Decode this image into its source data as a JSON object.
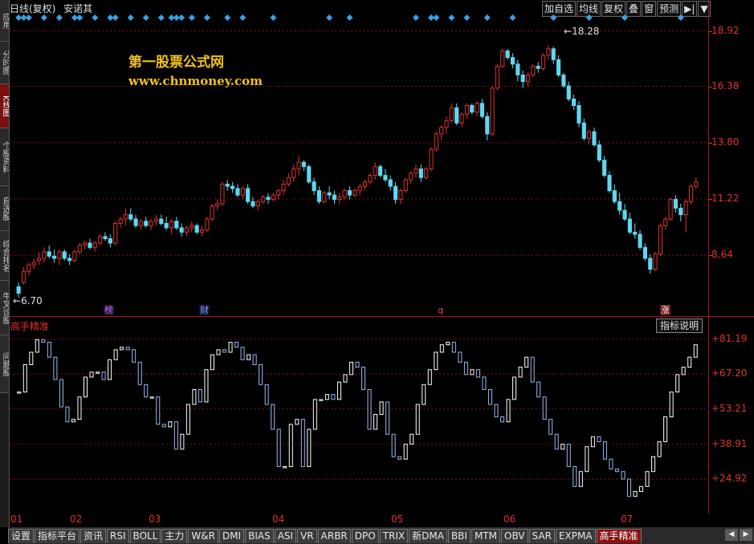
{
  "header": {
    "period": "日线(复权)",
    "stock_name": "安诺其",
    "buttons": [
      "加自选",
      "均线",
      "复权",
      "叠",
      "窗",
      "预测",
      "▶|",
      "▼"
    ]
  },
  "left_tabs": [
    {
      "label": "应用",
      "active": false
    },
    {
      "label": "分时图",
      "active": false
    },
    {
      "label": "K线图",
      "active": true
    },
    {
      "label": "个股资料",
      "active": false
    },
    {
      "label": "自选股",
      "active": false
    },
    {
      "label": "综合排名",
      "active": false
    },
    {
      "label": "牛叉诊股",
      "active": false
    },
    {
      "label": "问题股",
      "active": false
    }
  ],
  "watermark": {
    "line1": "第一股票公式网",
    "line2": "www.chnmoney.com"
  },
  "annotations": {
    "high": "18.28",
    "low": "6.70"
  },
  "events": [
    {
      "label": "榜",
      "color": "#c070ff",
      "bg": "#221122"
    },
    {
      "label": "财",
      "color": "#7aa8ff",
      "bg": "#111133"
    },
    {
      "label": "q",
      "color": "#ff4040",
      "bg": "transparent"
    },
    {
      "label": "涨",
      "color": "#ffffff",
      "bg": "#6a1111"
    }
  ],
  "price_axis": [
    "18.92",
    "16.38",
    "13.80",
    "11.22",
    "8.64"
  ],
  "indicator": {
    "name": "高手精准",
    "help_button": "指标说明",
    "axis": [
      "+81.19",
      "+67.20",
      "+53.21",
      "+38.91",
      "+24.92"
    ]
  },
  "months": [
    "01",
    "02",
    "03",
    "04",
    "05",
    "06",
    "07"
  ],
  "bottom_tabs": [
    "设置",
    "指标平台",
    "资讯",
    "RSI",
    "BOLL",
    "主力",
    "W&R",
    "DMI",
    "BIAS",
    "ASI",
    "VR",
    "ARBR",
    "DPO",
    "TRIX",
    "新DMA",
    "BBI",
    "MTM",
    "OBV",
    "SAR",
    "EXPMA",
    "高手精准"
  ],
  "active_bottom_tab": "高手精准",
  "colors": {
    "up": "#e03030",
    "down": "#5ed8f0",
    "grid": "#8a1010",
    "axis": "#e03030",
    "marker": "#3aa0e8",
    "ind_up": "#ffffff",
    "ind_down": "#9ab8f0"
  },
  "chart_data": {
    "type": "candlestick",
    "price_range": [
      6.0,
      19.6
    ],
    "ohlc": [
      [
        7.2,
        7.4,
        6.7,
        6.9
      ],
      [
        7.4,
        8.1,
        7.3,
        7.9
      ],
      [
        7.9,
        8.3,
        7.7,
        8.2
      ],
      [
        8.2,
        8.5,
        8.0,
        8.3
      ],
      [
        8.4,
        8.8,
        8.2,
        8.5
      ],
      [
        8.5,
        9.0,
        8.3,
        8.8
      ],
      [
        8.8,
        9.1,
        8.5,
        8.6
      ],
      [
        8.6,
        8.9,
        8.3,
        8.5
      ],
      [
        8.5,
        8.9,
        8.2,
        8.8
      ],
      [
        8.8,
        8.9,
        8.4,
        8.5
      ],
      [
        8.5,
        8.7,
        8.2,
        8.4
      ],
      [
        8.4,
        8.9,
        8.3,
        8.8
      ],
      [
        8.8,
        9.2,
        8.7,
        9.1
      ],
      [
        9.1,
        9.3,
        8.9,
        9.2
      ],
      [
        9.2,
        9.4,
        8.9,
        9.0
      ],
      [
        9.0,
        9.3,
        8.8,
        9.2
      ],
      [
        9.2,
        9.6,
        9.1,
        9.5
      ],
      [
        9.5,
        9.7,
        9.3,
        9.4
      ],
      [
        9.4,
        9.6,
        9.0,
        9.2
      ],
      [
        9.2,
        10.2,
        9.1,
        10.1
      ],
      [
        10.1,
        10.4,
        9.9,
        10.3
      ],
      [
        10.3,
        10.8,
        10.0,
        10.5
      ],
      [
        10.5,
        10.8,
        10.2,
        10.3
      ],
      [
        10.3,
        10.5,
        9.9,
        10.0
      ],
      [
        10.0,
        10.3,
        9.8,
        10.2
      ],
      [
        10.2,
        10.4,
        9.9,
        10.0
      ],
      [
        10.0,
        10.3,
        9.8,
        10.2
      ],
      [
        10.2,
        10.5,
        10.0,
        10.3
      ],
      [
        10.3,
        10.5,
        10.0,
        10.1
      ],
      [
        10.1,
        10.4,
        9.8,
        9.9
      ],
      [
        9.9,
        10.3,
        9.6,
        10.2
      ],
      [
        10.2,
        10.4,
        9.8,
        9.9
      ],
      [
        9.9,
        10.1,
        9.5,
        9.7
      ],
      [
        9.7,
        10.0,
        9.5,
        9.9
      ],
      [
        9.9,
        10.2,
        9.7,
        10.0
      ],
      [
        10.0,
        10.1,
        9.6,
        9.7
      ],
      [
        9.7,
        10.0,
        9.5,
        9.8
      ],
      [
        9.8,
        10.4,
        9.7,
        10.3
      ],
      [
        10.3,
        11.0,
        10.2,
        10.9
      ],
      [
        10.9,
        11.2,
        10.7,
        11.0
      ],
      [
        11.0,
        12.0,
        10.9,
        11.9
      ],
      [
        11.9,
        12.1,
        11.6,
        11.8
      ],
      [
        11.8,
        12.0,
        11.5,
        11.7
      ],
      [
        11.7,
        11.9,
        11.3,
        11.4
      ],
      [
        11.4,
        11.8,
        11.2,
        11.7
      ],
      [
        11.7,
        11.9,
        11.0,
        11.1
      ],
      [
        11.1,
        11.3,
        10.8,
        10.9
      ],
      [
        10.9,
        11.2,
        10.7,
        11.1
      ],
      [
        11.1,
        11.4,
        11.0,
        11.3
      ],
      [
        11.3,
        11.5,
        11.0,
        11.2
      ],
      [
        11.2,
        11.5,
        11.1,
        11.4
      ],
      [
        11.4,
        11.7,
        11.2,
        11.6
      ],
      [
        11.6,
        12.1,
        11.4,
        11.9
      ],
      [
        11.9,
        12.4,
        11.8,
        12.2
      ],
      [
        12.2,
        12.8,
        12.0,
        12.6
      ],
      [
        12.6,
        13.2,
        12.3,
        12.9
      ],
      [
        12.9,
        13.0,
        12.5,
        12.7
      ],
      [
        12.7,
        12.8,
        11.9,
        12.0
      ],
      [
        12.0,
        12.2,
        11.4,
        11.6
      ],
      [
        11.6,
        11.8,
        11.0,
        11.1
      ],
      [
        11.1,
        11.6,
        11.0,
        11.5
      ],
      [
        11.5,
        11.8,
        11.2,
        11.4
      ],
      [
        11.4,
        11.6,
        11.0,
        11.2
      ],
      [
        11.2,
        11.5,
        11.0,
        11.3
      ],
      [
        11.3,
        11.7,
        11.2,
        11.6
      ],
      [
        11.6,
        11.8,
        11.2,
        11.4
      ],
      [
        11.4,
        11.7,
        11.3,
        11.6
      ],
      [
        11.6,
        11.9,
        11.4,
        11.8
      ],
      [
        11.8,
        12.1,
        11.6,
        12.0
      ],
      [
        12.0,
        12.4,
        11.9,
        12.3
      ],
      [
        12.3,
        12.9,
        12.1,
        12.7
      ],
      [
        12.7,
        12.8,
        12.2,
        12.3
      ],
      [
        12.3,
        12.6,
        12.0,
        12.1
      ],
      [
        12.1,
        12.3,
        11.6,
        11.8
      ],
      [
        11.8,
        12.0,
        11.0,
        11.2
      ],
      [
        11.2,
        11.7,
        11.0,
        11.6
      ],
      [
        11.6,
        12.2,
        11.5,
        12.1
      ],
      [
        12.1,
        12.5,
        11.9,
        12.4
      ],
      [
        12.4,
        12.8,
        12.2,
        12.6
      ],
      [
        12.6,
        12.8,
        12.0,
        12.2
      ],
      [
        12.2,
        12.7,
        12.1,
        12.6
      ],
      [
        12.6,
        13.6,
        12.5,
        13.5
      ],
      [
        13.5,
        14.3,
        13.4,
        14.2
      ],
      [
        14.2,
        14.6,
        13.9,
        14.5
      ],
      [
        14.5,
        15.0,
        14.2,
        14.8
      ],
      [
        14.8,
        15.6,
        14.7,
        15.4
      ],
      [
        15.4,
        15.6,
        14.6,
        14.7
      ],
      [
        14.7,
        15.2,
        14.5,
        15.1
      ],
      [
        15.1,
        15.6,
        14.9,
        15.5
      ],
      [
        15.5,
        15.6,
        15.1,
        15.2
      ],
      [
        15.2,
        15.7,
        15.0,
        15.6
      ],
      [
        15.6,
        15.8,
        14.9,
        15.0
      ],
      [
        15.0,
        15.2,
        13.9,
        14.2
      ],
      [
        14.2,
        16.4,
        14.1,
        16.3
      ],
      [
        16.3,
        17.4,
        16.2,
        17.3
      ],
      [
        17.3,
        18.1,
        17.2,
        18.0
      ],
      [
        18.0,
        18.1,
        17.6,
        17.7
      ],
      [
        17.7,
        17.9,
        17.2,
        17.4
      ],
      [
        17.4,
        17.6,
        16.6,
        16.9
      ],
      [
        16.9,
        17.1,
        16.3,
        16.6
      ],
      [
        16.6,
        17.0,
        16.4,
        16.9
      ],
      [
        16.9,
        17.4,
        16.8,
        17.3
      ],
      [
        17.3,
        17.5,
        17.0,
        17.2
      ],
      [
        17.2,
        17.9,
        17.1,
        17.8
      ],
      [
        17.8,
        18.28,
        17.6,
        18.1
      ],
      [
        18.1,
        18.2,
        17.4,
        17.6
      ],
      [
        17.6,
        17.8,
        16.8,
        16.9
      ],
      [
        16.9,
        17.0,
        16.3,
        16.4
      ],
      [
        16.4,
        16.6,
        15.7,
        15.8
      ],
      [
        15.8,
        16.0,
        15.3,
        15.5
      ],
      [
        15.5,
        15.7,
        14.5,
        14.7
      ],
      [
        14.7,
        14.9,
        13.9,
        14.0
      ],
      [
        14.0,
        14.4,
        13.7,
        14.3
      ],
      [
        14.3,
        14.5,
        13.6,
        13.7
      ],
      [
        13.7,
        13.9,
        12.9,
        13.0
      ],
      [
        13.0,
        13.2,
        12.2,
        12.3
      ],
      [
        12.3,
        12.5,
        11.5,
        11.6
      ],
      [
        11.6,
        11.9,
        11.0,
        11.1
      ],
      [
        11.1,
        11.5,
        10.5,
        10.7
      ],
      [
        10.7,
        11.0,
        10.2,
        10.3
      ],
      [
        10.3,
        10.6,
        9.6,
        9.7
      ],
      [
        9.7,
        10.1,
        9.4,
        9.6
      ],
      [
        9.6,
        9.8,
        8.9,
        9.0
      ],
      [
        9.0,
        9.2,
        8.4,
        8.5
      ],
      [
        8.5,
        8.7,
        7.8,
        8.0
      ],
      [
        8.0,
        8.8,
        7.9,
        8.7
      ],
      [
        8.7,
        10.1,
        8.6,
        10.0
      ],
      [
        10.0,
        10.4,
        9.8,
        10.3
      ],
      [
        10.3,
        11.3,
        10.2,
        11.2
      ],
      [
        11.2,
        11.4,
        10.6,
        10.8
      ],
      [
        10.8,
        11.0,
        10.2,
        10.5
      ],
      [
        10.5,
        11.2,
        9.7,
        11.1
      ],
      [
        11.1,
        11.9,
        11.0,
        11.8
      ],
      [
        11.8,
        12.2,
        11.7,
        12.0
      ]
    ],
    "indicator": {
      "name": "高手精准",
      "range": [
        15,
        86
      ],
      "values": [
        60,
        71,
        76,
        81,
        80,
        74,
        65,
        54,
        48,
        49,
        58,
        66,
        68,
        68,
        65,
        73,
        77,
        78,
        77,
        72,
        63,
        58,
        58,
        47,
        46,
        48,
        37,
        43,
        55,
        61,
        56,
        69,
        75,
        77,
        76,
        80,
        78,
        73,
        75,
        71,
        63,
        55,
        45,
        30,
        30,
        47,
        49,
        30,
        45,
        57,
        57,
        59,
        57,
        64,
        67,
        72,
        70,
        61,
        45,
        51,
        56,
        43,
        34,
        33,
        39,
        43,
        55,
        63,
        69,
        76,
        79,
        80,
        76,
        72,
        67,
        69,
        66,
        61,
        55,
        50,
        48,
        57,
        66,
        70,
        74,
        64,
        58,
        49,
        43,
        37,
        39,
        30,
        22,
        28,
        38,
        42,
        40,
        33,
        29,
        28,
        25,
        18,
        20,
        22,
        28,
        34,
        40,
        50,
        60,
        67,
        70,
        74,
        79
      ]
    }
  }
}
